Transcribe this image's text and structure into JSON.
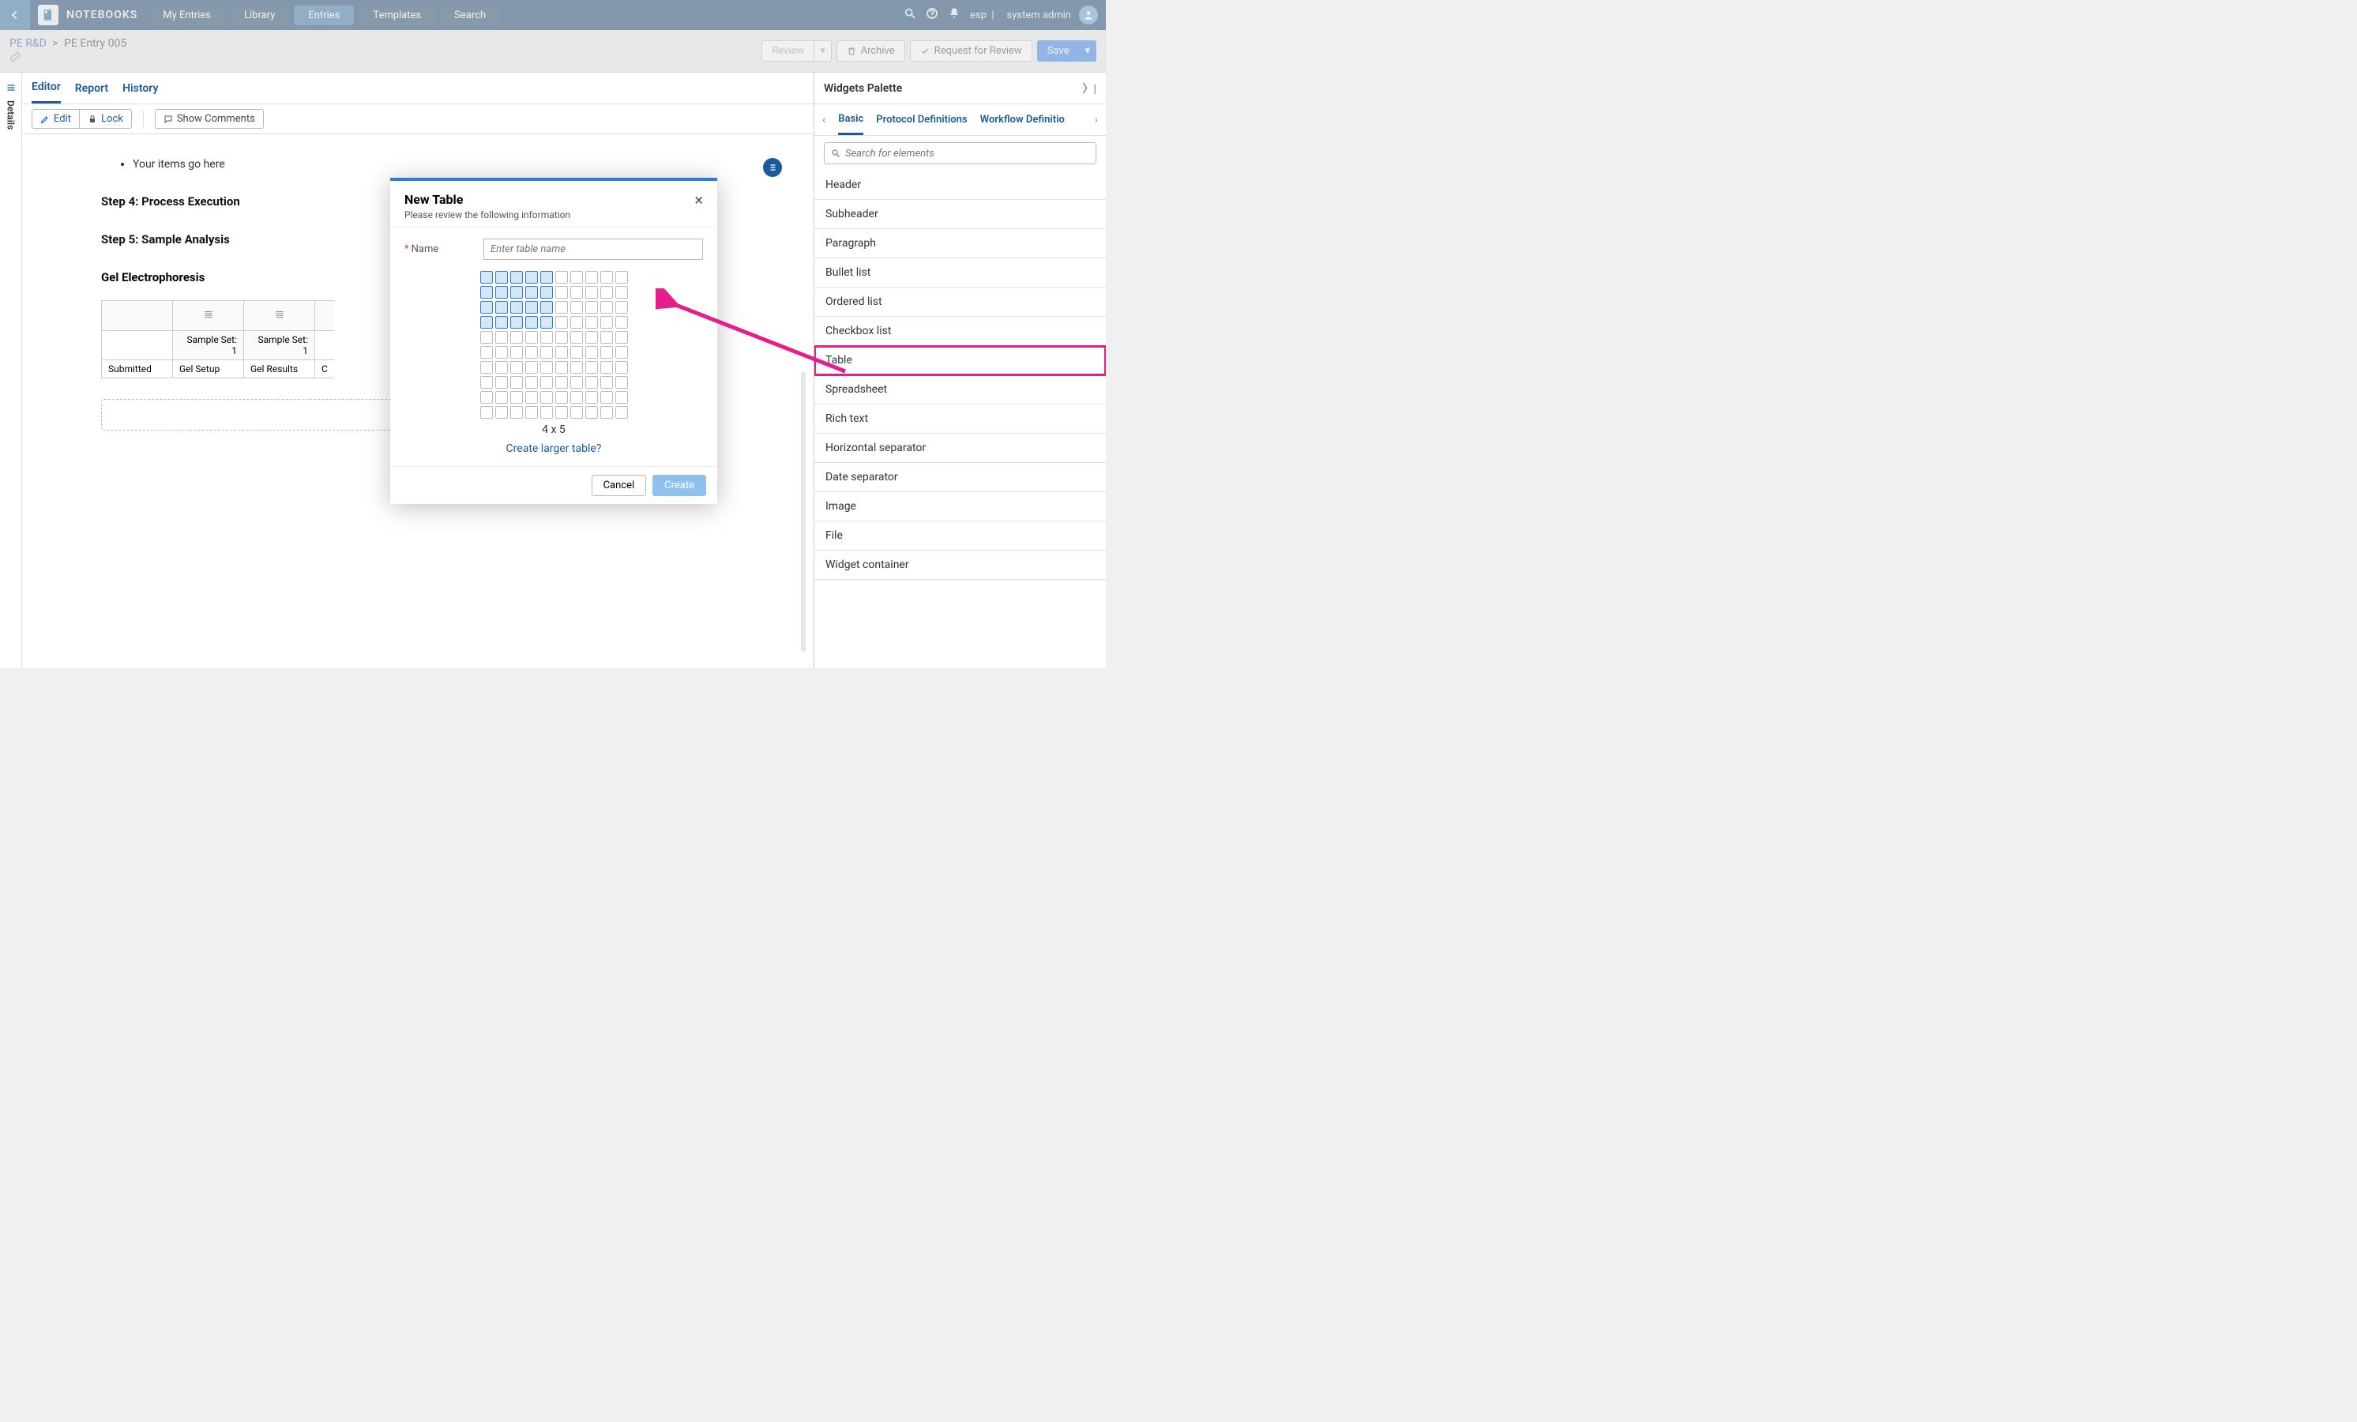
{
  "nav": {
    "title": "NOTEBOOKS",
    "tabs": [
      "My Entries",
      "Library",
      "Entries",
      "Templates",
      "Search"
    ],
    "active_tab_index": 2,
    "user_short": "esp",
    "user_name": "system admin"
  },
  "breadcrumb": {
    "parent": "PE R&D",
    "current": "PE Entry 005"
  },
  "header_buttons": {
    "review": "Review",
    "archive": "Archive",
    "request_review": "Request for Review",
    "save": "Save"
  },
  "view_tabs": {
    "editor": "Editor",
    "report": "Report",
    "history": "History"
  },
  "toolbar": {
    "edit": "Edit",
    "lock": "Lock",
    "show_comments": "Show Comments"
  },
  "details_label": "Details",
  "doc": {
    "bullet": "Your items go here",
    "step4": "Step 4: Process Execution",
    "step5": "Step 5: Sample Analysis",
    "gel_title": "Gel Electrophoresis",
    "table": {
      "rows": [
        [
          "",
          "",
          ""
        ],
        [
          "",
          "Sample Set:   1",
          "Sample Set:   1"
        ],
        [
          "Submitted",
          "Gel Setup",
          "Gel Results"
        ]
      ],
      "col4_partial": "C"
    },
    "dropzone": ""
  },
  "palette": {
    "title": "Widgets Palette",
    "tabs": [
      "Basic",
      "Protocol Definitions",
      "Workflow Definitio"
    ],
    "search_placeholder": "Search for elements",
    "items": [
      "Header",
      "Subheader",
      "Paragraph",
      "Bullet list",
      "Ordered list",
      "Checkbox list",
      "Table",
      "Spreadsheet",
      "Rich text",
      "Horizontal separator",
      "Date separator",
      "Image",
      "File",
      "Widget container"
    ],
    "highlight_index": 6
  },
  "modal": {
    "title": "New Table",
    "subtitle": "Please review the following information",
    "name_label": "Name",
    "name_placeholder": "Enter table name",
    "grid_rows": 10,
    "grid_cols": 10,
    "sel_rows": 4,
    "sel_cols": 5,
    "size_label": "4 x 5",
    "larger_link": "Create larger table?",
    "cancel": "Cancel",
    "create": "Create"
  }
}
